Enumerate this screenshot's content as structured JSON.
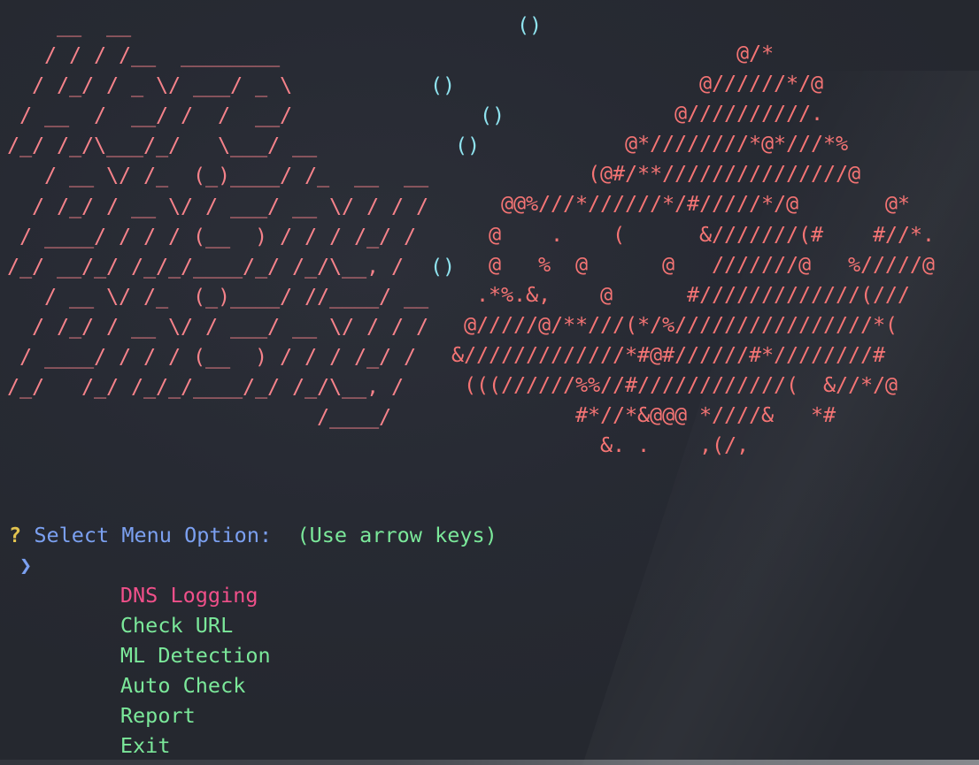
{
  "terminal": {
    "banner_ascii": "    __  __\n   / / / /__  ________\n  / /_/ / _ \\/ ___/ _ \\\n / __  /  __/ /  /  __/\n/_/ /_/\\___/_/   \\___/ __\n   / __ \\/ /_  (_)____/ /_  __  __\n  / /_/ / __ \\/ / ___/ __ \\/ / / /\n / ____/ / / / (__  ) / / / /_/ /\n/_/ __/_/ /_/_/____/_/ /_/\\__, /\n   / __ \\/ /_  (_)____/ //____/ __\n  / /_/ / __ \\/ / ___/ __ \\/ / / /\n / ____/ / / / (__  ) / / / /_/ /\n/_/   /_/ /_/_/____/_/ /_/\\__, /\n                         /____/",
    "bubbles_ascii": "       ()\n\n()\n    ()\n  ()\n\n\n\n()",
    "creature_ascii": "                       @/*\n                    @//////*/@\n                  @//////////.\n              @*////////*@*///*%\n           (@#/**///////////////@\n    @@%///*//////*/#/////*/@       @*\n   @    .    (      &///////(#    #//*.\n   @   %  @      @   ///////@   %/////@\n  .*%.&,    @      #/////////////(///\n @/////@/**///(*/%////////////////*(\n&/////////////*#@#//////#*////////#\n (((//////%%//#////////////(  &//*/@\n          #*//*&@@@ *////&   *#\n            &. .    ,(/,",
    "prompt": {
      "symbol": "?",
      "label": "Select Menu Option:",
      "hint": "(Use arrow keys)"
    },
    "pointer": "❯",
    "menu_options": [
      "DNS Logging",
      "Check URL",
      "ML Detection",
      "Auto Check",
      "Report",
      "Exit"
    ],
    "selected_index": 0,
    "colors": {
      "background": "#272a33",
      "banner": "#f5828a",
      "bubbles": "#8fe3ef",
      "creature": "#f47474",
      "prompt_label": "#7ba0f0",
      "question_mark": "#e3c44f",
      "option_text": "#7be89a",
      "selected_option": "#f0508a"
    }
  }
}
